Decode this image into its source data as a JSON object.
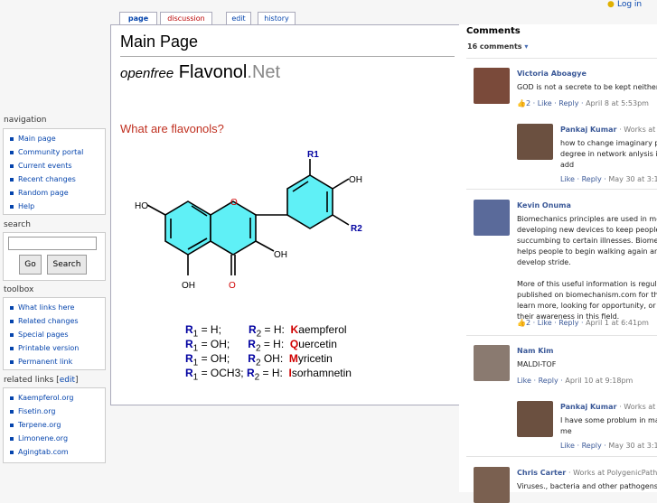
{
  "login": "Log in",
  "tabs": [
    {
      "label": "page"
    },
    {
      "label": "discussion"
    },
    {
      "label": "edit"
    },
    {
      "label": "history"
    }
  ],
  "page": {
    "title": "Main Page",
    "brand_prefix": "openfree",
    "brand_name": "Flavonol",
    "brand_suffix": ".Net",
    "question": "What are flavonols?"
  },
  "molecule": {
    "substituents": [
      "R1",
      "R2"
    ],
    "groups": [
      "HO",
      "OH",
      "OH",
      "OH",
      "O",
      "O"
    ]
  },
  "legend": [
    {
      "r1": "R",
      "r1sub": "1",
      "r1val": " = H;",
      "r2": "R",
      "r2sub": "2",
      "r2val": " = H:",
      "cap": "K",
      "rest": "aempferol"
    },
    {
      "r1": "R",
      "r1sub": "1",
      "r1val": " = OH;",
      "r2": "R",
      "r2sub": "2",
      "r2val": " = H:",
      "cap": "Q",
      "rest": "uercetin"
    },
    {
      "r1": "R",
      "r1sub": "1",
      "r1val": " = OH;",
      "r2": "R",
      "r2sub": "2",
      "r2val": " OH:",
      "cap": "M",
      "rest": "yricetin"
    },
    {
      "r1": "R",
      "r1sub": "1",
      "r1val": " = OCH3;",
      "r2": "R",
      "r2sub": "2",
      "r2val": " = H:",
      "cap": "I",
      "rest": "sorhamnetin"
    }
  ],
  "sidebar": {
    "navigation": {
      "heading": "navigation",
      "items": [
        "Main page",
        "Community portal",
        "Current events",
        "Recent changes",
        "Random page",
        "Help"
      ]
    },
    "search": {
      "heading": "search",
      "go": "Go",
      "search": "Search"
    },
    "toolbox": {
      "heading": "toolbox",
      "items": [
        "What links here",
        "Related changes",
        "Special pages",
        "Printable version",
        "Permanent link"
      ]
    },
    "related": {
      "heading": "related links",
      "edit": "edit",
      "items": [
        "Kaempferol.org",
        "Fisetin.org",
        "Terpene.org",
        "Limonene.org",
        "Agingtab.com"
      ]
    }
  },
  "comments": {
    "title": "Comments",
    "count": "16 comments",
    "list": [
      {
        "name": "Victoria Aboagye",
        "work": "",
        "text": "GOD is not a secrete to be kept neither a",
        "likes": "2",
        "actions": "Like · Reply ·",
        "date": "April 8 at 5:53pm",
        "color": "#7a4a3a"
      },
      {
        "name": "Pankaj Kumar",
        "work": "· Works at S",
        "text": "how to change imaginary pa\ndegree in network anlysis in\nadd",
        "likes": "",
        "actions": "Like · Reply ·",
        "date": "May 30 at 3:1",
        "color": "#6b5040"
      },
      {
        "name": "Kevin Onuma",
        "work": "",
        "text": "Biomechanics principles are used in med\ndeveloping new devices to keep people f\nsuccumbing to certain illnesses. Biomec\nhelps people to begin walking again and\ndevelop stride.\n\nMore of this useful information is regular\npublished on biomechanism.com for thos\nlearn more, looking for opportunity, or to\ntheir awareness in this field.",
        "likes": "2",
        "actions": "Like · Reply ·",
        "date": "April 1 at 6:41pm",
        "color": "#5a6a9a"
      },
      {
        "name": "Nam Kim",
        "work": "",
        "text": "MALDI-TOF",
        "likes": "",
        "actions": "Like · Reply ·",
        "date": "April 10 at 9:18pm",
        "color": "#8a7a70"
      },
      {
        "name": "Pankaj Kumar",
        "work": "· Works at S",
        "text": "I have some problum in mat\nme",
        "likes": "",
        "actions": "Like · Reply ·",
        "date": "May 30 at 3:1",
        "color": "#6b5040"
      },
      {
        "name": "Chris Carter",
        "work": "· Works at PolygenicPathw",
        "text": "Viruses., bacteria and other pathogens h",
        "likes": "",
        "actions": "",
        "date": "",
        "color": "#7a6050"
      }
    ]
  },
  "colors": {
    "link": "#0645ad",
    "ring_fill": "#5ff0f6",
    "legend_r": "#0000a0",
    "legend_cap": "#d00000",
    "question": "#c03020",
    "fb_link": "#3b5998"
  }
}
